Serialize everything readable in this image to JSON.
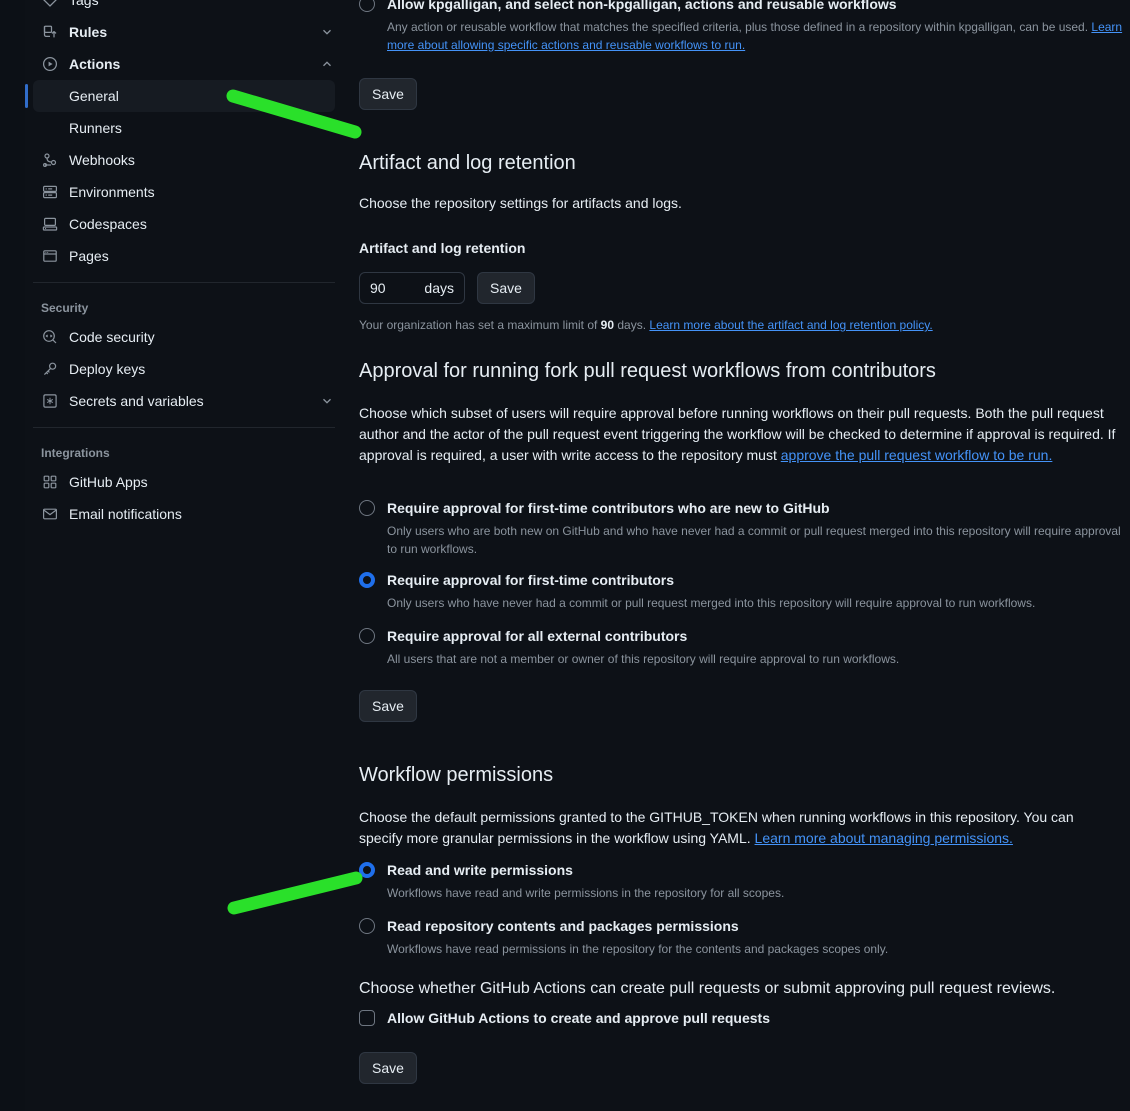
{
  "theme": {
    "bg": "#0d1117",
    "accent_blue": "#1f6feb",
    "link": "#4493f8",
    "muted": "#8b949e",
    "annotation_green": "#22dd22"
  },
  "sidebar": {
    "items": [
      {
        "label": "Tags",
        "icon": "tag-icon",
        "chevron": "",
        "type": "item"
      },
      {
        "label": "Rules",
        "icon": "rules-icon",
        "chevron": "chevron-down-icon",
        "type": "item",
        "bold": true
      },
      {
        "label": "Actions",
        "icon": "play-circle-icon",
        "chevron": "chevron-up-icon",
        "type": "item",
        "bold": true
      },
      {
        "label": "General",
        "type": "sub",
        "active": true
      },
      {
        "label": "Runners",
        "type": "sub",
        "active": false
      },
      {
        "label": "Webhooks",
        "icon": "webhook-icon",
        "type": "item"
      },
      {
        "label": "Environments",
        "icon": "server-icon",
        "type": "item"
      },
      {
        "label": "Codespaces",
        "icon": "codespaces-icon",
        "type": "item"
      },
      {
        "label": "Pages",
        "icon": "browser-icon",
        "type": "item"
      }
    ],
    "security_heading": "Security",
    "security_items": [
      {
        "label": "Code security",
        "icon": "code-review-icon",
        "chevron": ""
      },
      {
        "label": "Deploy keys",
        "icon": "key-icon",
        "chevron": ""
      },
      {
        "label": "Secrets and variables",
        "icon": "asterisk-box-icon",
        "chevron": "chevron-down-icon"
      }
    ],
    "integrations_heading": "Integrations",
    "integrations_items": [
      {
        "label": "GitHub Apps",
        "icon": "apps-grid-icon"
      },
      {
        "label": "Email notifications",
        "icon": "mail-icon"
      }
    ]
  },
  "allowed_actions": {
    "option_label": "Allow kpgalligan, and select non-kpgalligan, actions and reusable workflows",
    "option_desc_before": "Any action or reusable workflow that matches the specified criteria, plus those defined in a repository within kpgalligan, can be used. ",
    "option_desc_link": "Learn more about allowing specific actions and reusable workflows to run.",
    "selected": false,
    "save_label": "Save"
  },
  "artifact_retention": {
    "heading": "Artifact and log retention",
    "description": "Choose the repository settings for artifacts and logs.",
    "field_label": "Artifact and log retention",
    "value": "90",
    "unit": "days",
    "save_label": "Save",
    "note_before": "Your organization has set a maximum limit of ",
    "note_bold": "90",
    "note_after": " days. ",
    "note_link": "Learn more about the artifact and log retention policy."
  },
  "fork_approval": {
    "heading": "Approval for running fork pull request workflows from contributors",
    "description_before": "Choose which subset of users will require approval before running workflows on their pull requests. Both the pull request author and the actor of the pull request event triggering the workflow will be checked to determine if approval is required. If approval is required, a user with write access to the repository must ",
    "description_link": "approve the pull request workflow to be run.",
    "options": [
      {
        "label": "Require approval for first-time contributors who are new to GitHub",
        "desc": "Only users who are both new on GitHub and who have never had a commit or pull request merged into this repository will require approval to run workflows.",
        "selected": false
      },
      {
        "label": "Require approval for first-time contributors",
        "desc": "Only users who have never had a commit or pull request merged into this repository will require approval to run workflows.",
        "selected": true
      },
      {
        "label": "Require approval for all external contributors",
        "desc": "All users that are not a member or owner of this repository will require approval to run workflows.",
        "selected": false
      }
    ],
    "save_label": "Save"
  },
  "workflow_permissions": {
    "heading": "Workflow permissions",
    "description_before": "Choose the default permissions granted to the GITHUB_TOKEN when running workflows in this repository. You can specify more granular permissions in the workflow using YAML. ",
    "description_link": "Learn more about managing permissions.",
    "options": [
      {
        "label": "Read and write permissions",
        "desc": "Workflows have read and write permissions in the repository for all scopes.",
        "selected": true
      },
      {
        "label": "Read repository contents and packages permissions",
        "desc": "Workflows have read permissions in the repository for the contents and packages scopes only.",
        "selected": false
      }
    ],
    "pr_question": "Choose whether GitHub Actions can create pull requests or submit approving pull request reviews.",
    "pr_checkbox_label": "Allow GitHub Actions to create and approve pull requests",
    "pr_checkbox_checked": false,
    "save_label": "Save"
  }
}
